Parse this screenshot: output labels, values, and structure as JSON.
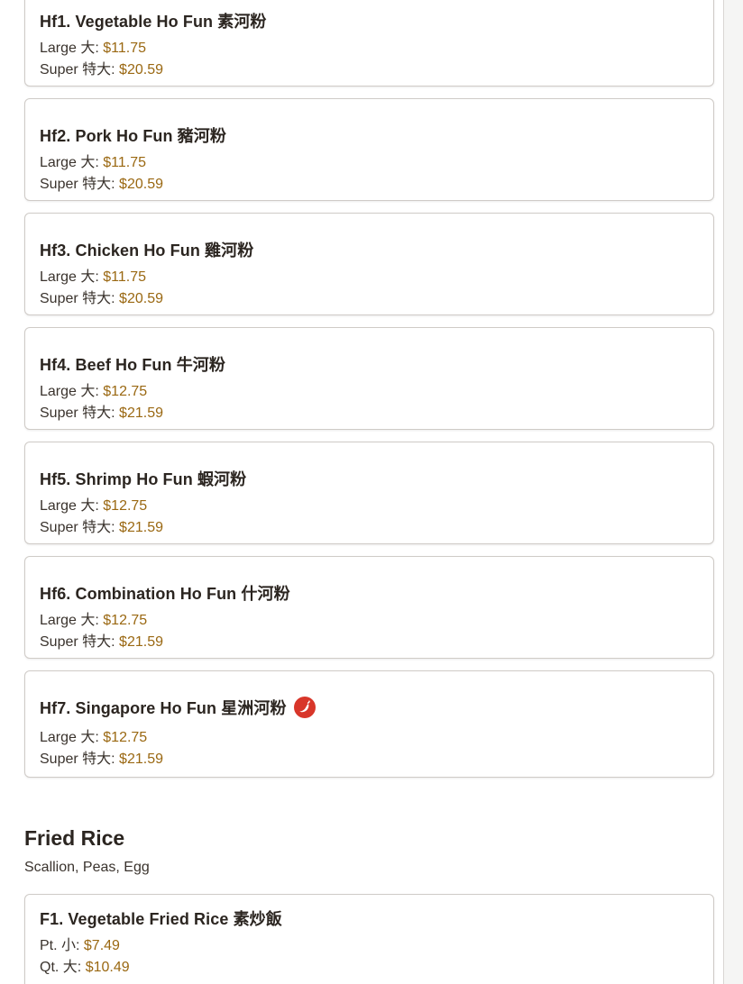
{
  "ho_fun": {
    "items": [
      {
        "title": "Hf1. Vegetable Ho Fun 素河粉",
        "prices": [
          {
            "label": "Large 大: ",
            "value": "$11.75"
          },
          {
            "label": "Super 特大: ",
            "value": "$20.59"
          }
        ]
      },
      {
        "title": "Hf2. Pork Ho Fun 豬河粉",
        "prices": [
          {
            "label": "Large 大: ",
            "value": "$11.75"
          },
          {
            "label": "Super 特大: ",
            "value": "$20.59"
          }
        ]
      },
      {
        "title": "Hf3. Chicken Ho Fun 雞河粉",
        "prices": [
          {
            "label": "Large 大: ",
            "value": "$11.75"
          },
          {
            "label": "Super 特大: ",
            "value": "$20.59"
          }
        ]
      },
      {
        "title": "Hf4. Beef Ho Fun 牛河粉",
        "prices": [
          {
            "label": "Large 大: ",
            "value": "$12.75"
          },
          {
            "label": "Super 特大: ",
            "value": "$21.59"
          }
        ]
      },
      {
        "title": "Hf5. Shrimp Ho Fun 蝦河粉",
        "prices": [
          {
            "label": "Large 大: ",
            "value": "$12.75"
          },
          {
            "label": "Super 特大: ",
            "value": "$21.59"
          }
        ]
      },
      {
        "title": "Hf6. Combination Ho Fun 什河粉",
        "prices": [
          {
            "label": "Large 大: ",
            "value": "$12.75"
          },
          {
            "label": "Super 特大: ",
            "value": "$21.59"
          }
        ]
      },
      {
        "title": "Hf7. Singapore Ho Fun 星洲河粉",
        "spicy": true,
        "spicy_icon": "chili-pepper-icon",
        "prices": [
          {
            "label": "Large 大: ",
            "value": "$12.75"
          },
          {
            "label": "Super 特大: ",
            "value": "$21.59"
          }
        ]
      }
    ]
  },
  "fried_rice": {
    "heading": "Fried Rice",
    "description": "Scallion, Peas, Egg",
    "items": [
      {
        "title": "F1. Vegetable Fried Rice 素炒飯",
        "prices": [
          {
            "label": "Pt. 小: ",
            "value": "$7.49"
          },
          {
            "label": "Qt. 大: ",
            "value": "$10.49"
          }
        ]
      }
    ]
  },
  "colors": {
    "price": "#9a6812",
    "spicy": "#d8362a",
    "card_border": "#cfcbc7",
    "text": "#2b2520"
  }
}
